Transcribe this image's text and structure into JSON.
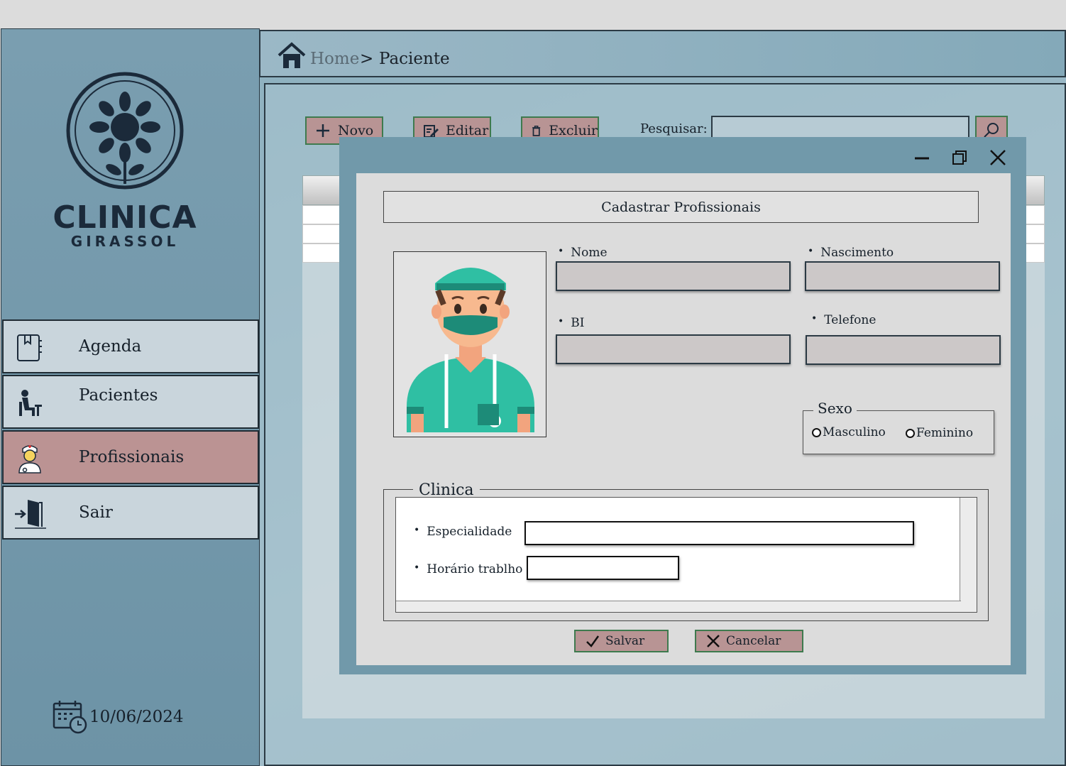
{
  "sidebar": {
    "logo": {
      "line1": "CLINICA",
      "line2": "GIRASSOL"
    },
    "items": [
      {
        "label": "Agenda",
        "icon": "agenda-book-icon",
        "active": false
      },
      {
        "label": "Pacientes",
        "icon": "patient-icon",
        "active": false
      },
      {
        "label": "Profissionais",
        "icon": "nurse-icon",
        "active": true
      },
      {
        "label": "Sair",
        "icon": "exit-door-icon",
        "active": false
      }
    ],
    "date": "10/06/2024"
  },
  "breadcrumb": {
    "home": "Home",
    "separator": ">",
    "current": "Paciente"
  },
  "toolbar": {
    "new_label": "Novo",
    "edit_label": "Editar",
    "delete_label": "Excluir",
    "search_label": "Pesquisar:",
    "search_value": ""
  },
  "modal": {
    "title": "Cadastrar Profissionais",
    "fields": {
      "nome": {
        "label": "Nome",
        "value": ""
      },
      "nascimento": {
        "label": "Nascimento",
        "value": ""
      },
      "bi": {
        "label": "BI",
        "value": ""
      },
      "telefone": {
        "label": "Telefone",
        "value": ""
      }
    },
    "sexo": {
      "legend": "Sexo",
      "options": [
        "Masculino",
        "Feminino"
      ]
    },
    "clinica": {
      "legend": "Clinica",
      "especialidade_label": "Especialidade",
      "especialidade_value": "",
      "horario_label": "Horário trablho",
      "horario_value": ""
    },
    "save_label": "Salvar",
    "cancel_label": "Cancelar"
  },
  "colors": {
    "sidebar_bg": "#7a9eb0",
    "active_nav": "#bb9393",
    "button_bg": "#b89494",
    "button_border": "#3e7a4e",
    "modal_frame": "#7199aa"
  }
}
